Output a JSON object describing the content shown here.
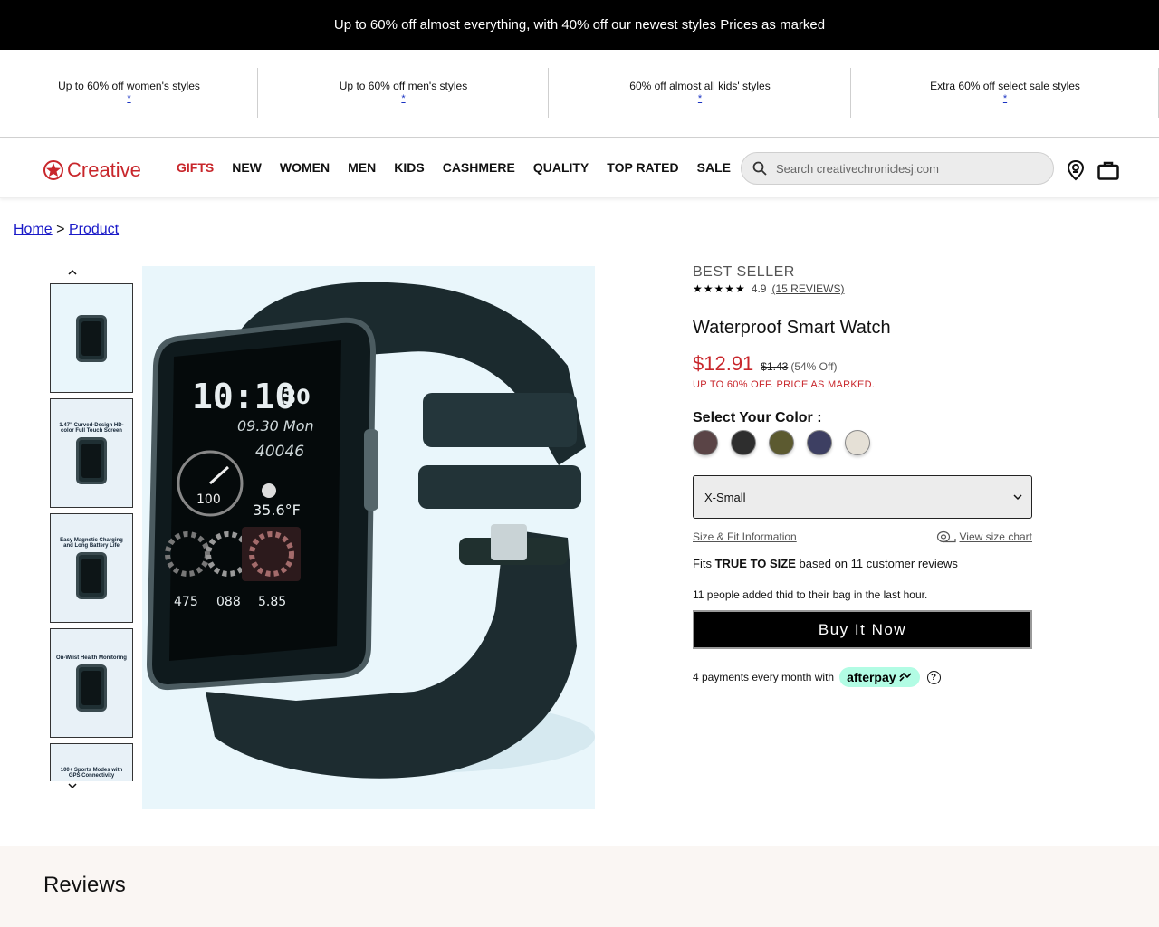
{
  "announcement": "Up to 60% off almost everything, with 40% off our newest styles Prices as marked",
  "promos": [
    {
      "text": "Up to 60% off women's styles",
      "mark": "*"
    },
    {
      "text": "Up to 60% off men's styles",
      "mark": "*"
    },
    {
      "text": "60% off almost all kids' styles",
      "mark": "*"
    },
    {
      "text": "Extra 60% off select sale styles",
      "mark": "*"
    }
  ],
  "brand": {
    "name": "Creative",
    "color": "#c8262b"
  },
  "nav": [
    "GIFTS",
    "NEW",
    "WOMEN",
    "MEN",
    "KIDS",
    "CASHMERE",
    "QUALITY",
    "TOP RATED",
    "SALE"
  ],
  "search": {
    "placeholder": "Search creativechroniclesj.com"
  },
  "header_icons": [
    "store-locator-icon",
    "shopping-bag-icon"
  ],
  "breadcrumb": {
    "home": "Home",
    "sep": ">",
    "current": "Product"
  },
  "thumbnails": [
    {
      "caption": ""
    },
    {
      "caption": "1.47\" Curved-Design HD-color Full Touch Screen"
    },
    {
      "caption": "Easy Magnetic Charging and Long Battery Life"
    },
    {
      "caption": "On-Wrist Health Monitoring"
    },
    {
      "caption": "100+ Sports Modes with GPS Connectivity"
    }
  ],
  "hero_watch": {
    "time": "10:10",
    "seconds": "30",
    "date": "09.30 Mon",
    "steps": "40046",
    "temp": "35.6°F",
    "power": "100",
    "stats": [
      "475",
      "088",
      "5.85"
    ]
  },
  "product": {
    "badge": "BEST SELLER",
    "rating": "4.9",
    "reviews_link": "(15 REVIEWS)",
    "title": "Waterproof Smart Watch",
    "price": "$12.91",
    "original_price": "$1.43",
    "discount": "(54% Off)",
    "promo_note": "UP TO 60% OFF. PRICE AS MARKED.",
    "color_label": "Select Your Color :",
    "colors": [
      "#5a4446",
      "#2e2e2e",
      "#5c5a30",
      "#3d3f62",
      "#e5e0d6"
    ],
    "size_selected": "X-Small",
    "size_fit_link": "Size & Fit Information",
    "size_chart_link": "View size chart",
    "fits_prefix": "Fits",
    "fits_bold": "TRUE TO SIZE",
    "fits_mid": "based on",
    "fits_link": "11 customer reviews",
    "social_proof": "11 people added thid to their bag in the last hour.",
    "buy_label": "Buy It Now",
    "payments_text": "4 payments every month with",
    "afterpay_label": "afterpay",
    "help_mark": "?"
  },
  "reviews": {
    "heading": "Reviews"
  }
}
